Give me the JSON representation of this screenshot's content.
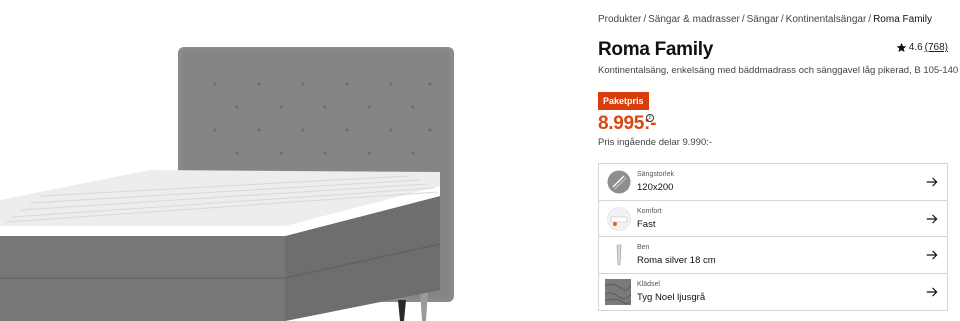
{
  "breadcrumb": {
    "items": [
      "Produkter",
      "Sängar & madrasser",
      "Sängar",
      "Kontinentalsängar"
    ],
    "separator": "/",
    "current": "Roma Family"
  },
  "product": {
    "title": "Roma Family",
    "subtitle": "Kontinentalsäng, enkelsäng med bäddmadrass och sänggavel låg pikerad, B 105-140",
    "rating": {
      "score": "4.6",
      "count": "(768)"
    },
    "badge": "Paketpris",
    "price": "8.995:-",
    "price_note": "Pris ingående delar 9.990:-"
  },
  "options": [
    {
      "label": "Sängstorlek",
      "value": "120x200",
      "icon": "size-icon"
    },
    {
      "label": "Komfort",
      "value": "Fast",
      "icon": "comfort-icon"
    },
    {
      "label": "Ben",
      "value": "Roma silver 18 cm",
      "icon": "leg-icon"
    },
    {
      "label": "Klädsel",
      "value": "Tyg Noel ljusgrå",
      "icon": "fabric-swatch-icon"
    }
  ],
  "colors": {
    "accent": "#d9480f",
    "badge_bg": "#d93d0c",
    "upholstery": "#7d7d7d"
  }
}
